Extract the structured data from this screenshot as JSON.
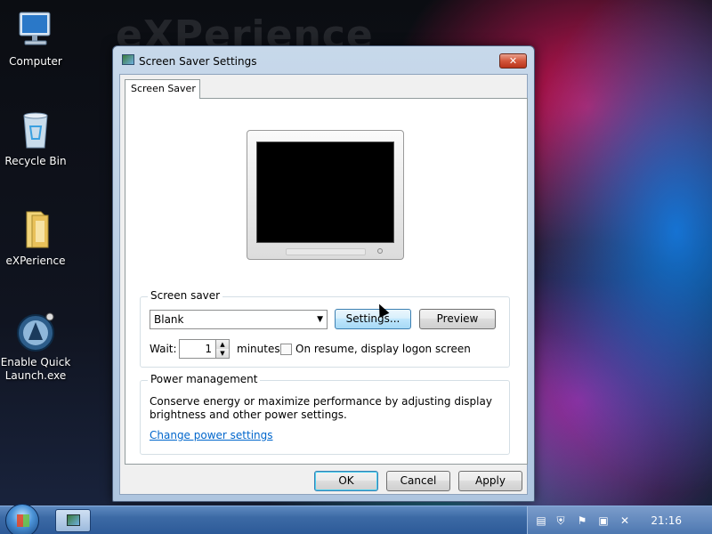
{
  "wallpaper": {
    "text": "eXPerience"
  },
  "desktop": {
    "icons": [
      {
        "label": "Computer",
        "icon": "computer-icon"
      },
      {
        "label": "Recycle Bin",
        "icon": "recycle-bin-icon"
      },
      {
        "label": "eXPerience",
        "icon": "folder-icon"
      },
      {
        "label": "Enable Quick Launch.exe",
        "icon": "quick-launch-app-icon"
      }
    ]
  },
  "dialog": {
    "title": "Screen Saver Settings",
    "close_glyph": "✕",
    "tab_label": "Screen Saver",
    "screen_saver": {
      "group_label": "Screen saver",
      "selected": "Blank",
      "settings_button": "Settings...",
      "preview_button": "Preview",
      "wait_label": "Wait:",
      "wait_value": "1",
      "minutes_label": "minutes",
      "resume_checkbox_label": "On resume, display logon screen",
      "resume_checked": false
    },
    "power": {
      "group_label": "Power management",
      "description_line1": "Conserve energy or maximize performance by adjusting display",
      "description_line2": "brightness and other power settings.",
      "link": "Change power settings"
    },
    "buttons": {
      "ok": "OK",
      "cancel": "Cancel",
      "apply": "Apply"
    }
  },
  "taskbar": {
    "clock": "21:16",
    "tray_icons": [
      "notification-icon",
      "security-icon",
      "action-center-flag-icon",
      "network-icon",
      "volume-muted-icon"
    ]
  },
  "colors": {
    "accent": "#3c7fb1",
    "link": "#0066cc",
    "close": "#c8432a"
  }
}
